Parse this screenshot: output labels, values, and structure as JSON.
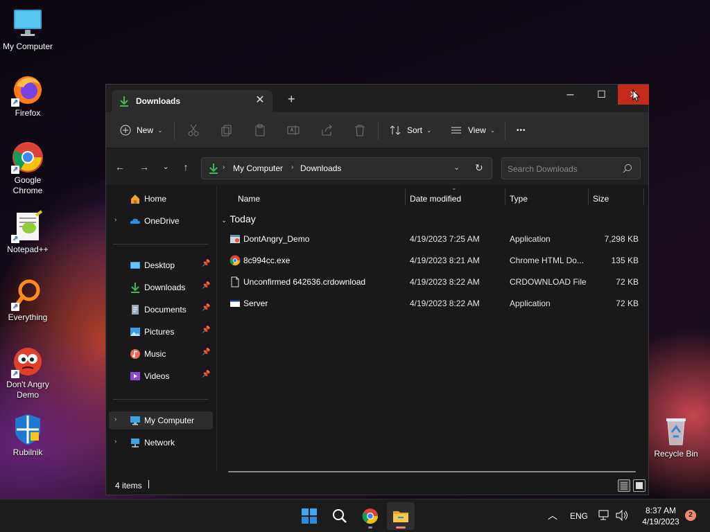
{
  "desktop": {
    "icons": [
      {
        "label": "My Computer",
        "icon": "monitor-icon"
      },
      {
        "label": "Firefox",
        "icon": "firefox-icon"
      },
      {
        "label": "Google Chrome",
        "icon": "chrome-icon"
      },
      {
        "label": "Notepad++",
        "icon": "notepadpp-icon"
      },
      {
        "label": "Everything",
        "icon": "everything-icon"
      },
      {
        "label": "Don't Angry Demo",
        "icon": "dontangry-icon"
      },
      {
        "label": "Rubilnik",
        "icon": "shield-icon"
      },
      {
        "label": "Recycle Bin",
        "icon": "recycle-bin-icon"
      }
    ]
  },
  "window": {
    "tab_title": "Downloads",
    "new_tab_symbol": "+",
    "close_tab_symbol": "✕",
    "controls": {
      "minimize": "─",
      "maximize": "☐",
      "close": "✕"
    }
  },
  "commandbar": {
    "new_label": "New",
    "sort_label": "Sort",
    "view_label": "View",
    "more_label": "•••"
  },
  "navigation": {
    "breadcrumb": [
      "My Computer",
      "Downloads"
    ],
    "search_placeholder": "Search Downloads"
  },
  "sidebar": {
    "top": [
      {
        "label": "Home",
        "icon": "home-icon"
      },
      {
        "label": "OneDrive",
        "icon": "onedrive-icon"
      }
    ],
    "quick_access": [
      {
        "label": "Desktop",
        "icon": "desktop-folder-icon",
        "pinned": true
      },
      {
        "label": "Downloads",
        "icon": "downloads-icon",
        "pinned": true
      },
      {
        "label": "Documents",
        "icon": "documents-icon",
        "pinned": true
      },
      {
        "label": "Pictures",
        "icon": "pictures-icon",
        "pinned": true
      },
      {
        "label": "Music",
        "icon": "music-icon",
        "pinned": true
      },
      {
        "label": "Videos",
        "icon": "videos-icon",
        "pinned": true
      }
    ],
    "bottom": [
      {
        "label": "My Computer",
        "icon": "computer-icon",
        "selected": true
      },
      {
        "label": "Network",
        "icon": "network-icon"
      }
    ]
  },
  "files": {
    "columns": {
      "name": "Name",
      "date": "Date modified",
      "type": "Type",
      "size": "Size"
    },
    "group": "Today",
    "rows": [
      {
        "name": "DontAngry_Demo",
        "date": "4/19/2023 7:25 AM",
        "type": "Application",
        "size": "7,298 KB",
        "icon": "application-icon"
      },
      {
        "name": "8c994cc.exe",
        "date": "4/19/2023 8:21 AM",
        "type": "Chrome HTML Do...",
        "size": "135 KB",
        "icon": "chrome-file-icon"
      },
      {
        "name": "Unconfirmed 642636.crdownload",
        "date": "4/19/2023 8:22 AM",
        "type": "CRDOWNLOAD File",
        "size": "72 KB",
        "icon": "blank-file-icon"
      },
      {
        "name": "Server",
        "date": "4/19/2023 8:22 AM",
        "type": "Application",
        "size": "72 KB",
        "icon": "application-window-icon"
      }
    ]
  },
  "statusbar": {
    "item_count": "4 items"
  },
  "taskbar": {
    "apps": [
      "start-icon",
      "search-icon",
      "chrome-icon",
      "file-explorer-icon"
    ],
    "language": "ENG",
    "time": "8:37 AM",
    "date": "4/19/2023",
    "notification_count": "2"
  },
  "colors": {
    "accent": "#c42b1c",
    "download_green": "#3fb950",
    "folder_yellow": "#f2c94c"
  }
}
